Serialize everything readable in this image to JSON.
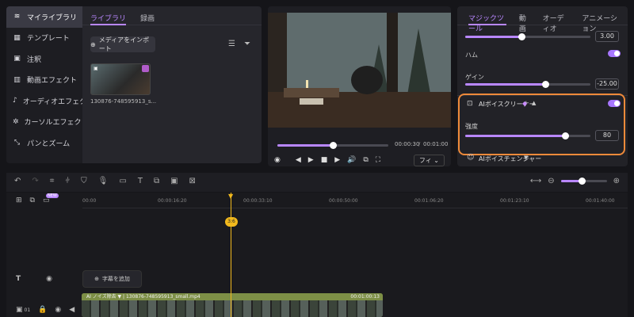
{
  "sidebar": {
    "items": [
      {
        "label": "マイライブラリ",
        "icon": "layers-icon",
        "active": true
      },
      {
        "label": "テンプレート",
        "icon": "template-icon"
      },
      {
        "label": "注釈",
        "icon": "annotation-icon"
      },
      {
        "label": "動画エフェクト",
        "icon": "effects-icon"
      },
      {
        "label": "オーディオエフェクト",
        "icon": "audio-effects-icon"
      },
      {
        "label": "カーソルエフェクト",
        "icon": "cursor-effects-icon"
      },
      {
        "label": "パンとズーム",
        "icon": "pan-zoom-icon"
      }
    ]
  },
  "library": {
    "tabs": [
      "ライブラリ",
      "録画"
    ],
    "import_label": "メディアをインポート",
    "thumb_name": "130876-748595913_s..."
  },
  "preview": {
    "current_time": "00:00:30",
    "total_time": "00:01:00",
    "progress": 0.5,
    "fit_label": "フィ"
  },
  "right_panel": {
    "tabs": [
      "マジックツール",
      "動画",
      "オーディオ",
      "アニメーション"
    ],
    "value_top": "3.00",
    "hum_label": "ハム",
    "gain_label": "ゲイン",
    "gain_value": "-25.00",
    "cleaner_label": "AIボイスクリーナー",
    "intensity_label": "強度",
    "intensity_value": "80",
    "changer_label": "AIボイスチェンジャー"
  },
  "timeline": {
    "ticks": [
      "00:00",
      "00:00:16:20",
      "00:00:33:10",
      "00:00:50:00",
      "00:01:06:20",
      "00:01:23:10",
      "00:01:40:00"
    ],
    "subtitle_add": "字幕を追加",
    "new_badge": "NEW",
    "playhead_label": "3:6",
    "track_num": "01",
    "clip_name": "AI ノイズ除去 ▼ | 130876-748595913_small.mp4",
    "clip_duration": "00:01:00:13"
  },
  "colors": {
    "accent": "#b987ff",
    "highlight": "#ef8a3a",
    "playhead": "#f2b91d"
  }
}
